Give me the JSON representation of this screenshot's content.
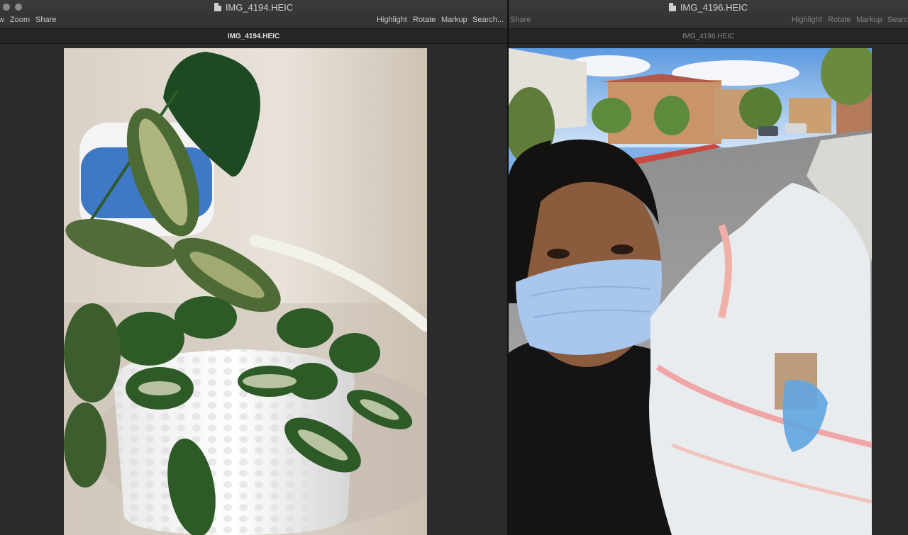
{
  "left_window": {
    "title": "IMG_4194.HEIC",
    "tab_title": "IMG_4194.HEIC",
    "toolbar_left": [
      "w",
      "Zoom",
      "Share"
    ],
    "toolbar_right": [
      "Highlight",
      "Rotate",
      "Markup",
      "Search..."
    ]
  },
  "right_window": {
    "title": "IMG_4196.HEIC",
    "tab_title": "IMG_4196.HEIC",
    "toolbar_left": [
      "Share"
    ],
    "toolbar_right": [
      "Highlight",
      "Rotate",
      "Markup",
      "Search"
    ]
  },
  "icons": {
    "document": "doc-icon",
    "window_control": "traffic-light-icon"
  },
  "colors": {
    "titlebar": "#353535",
    "background": "#2b2b2b",
    "text": "#d8d8d8"
  }
}
